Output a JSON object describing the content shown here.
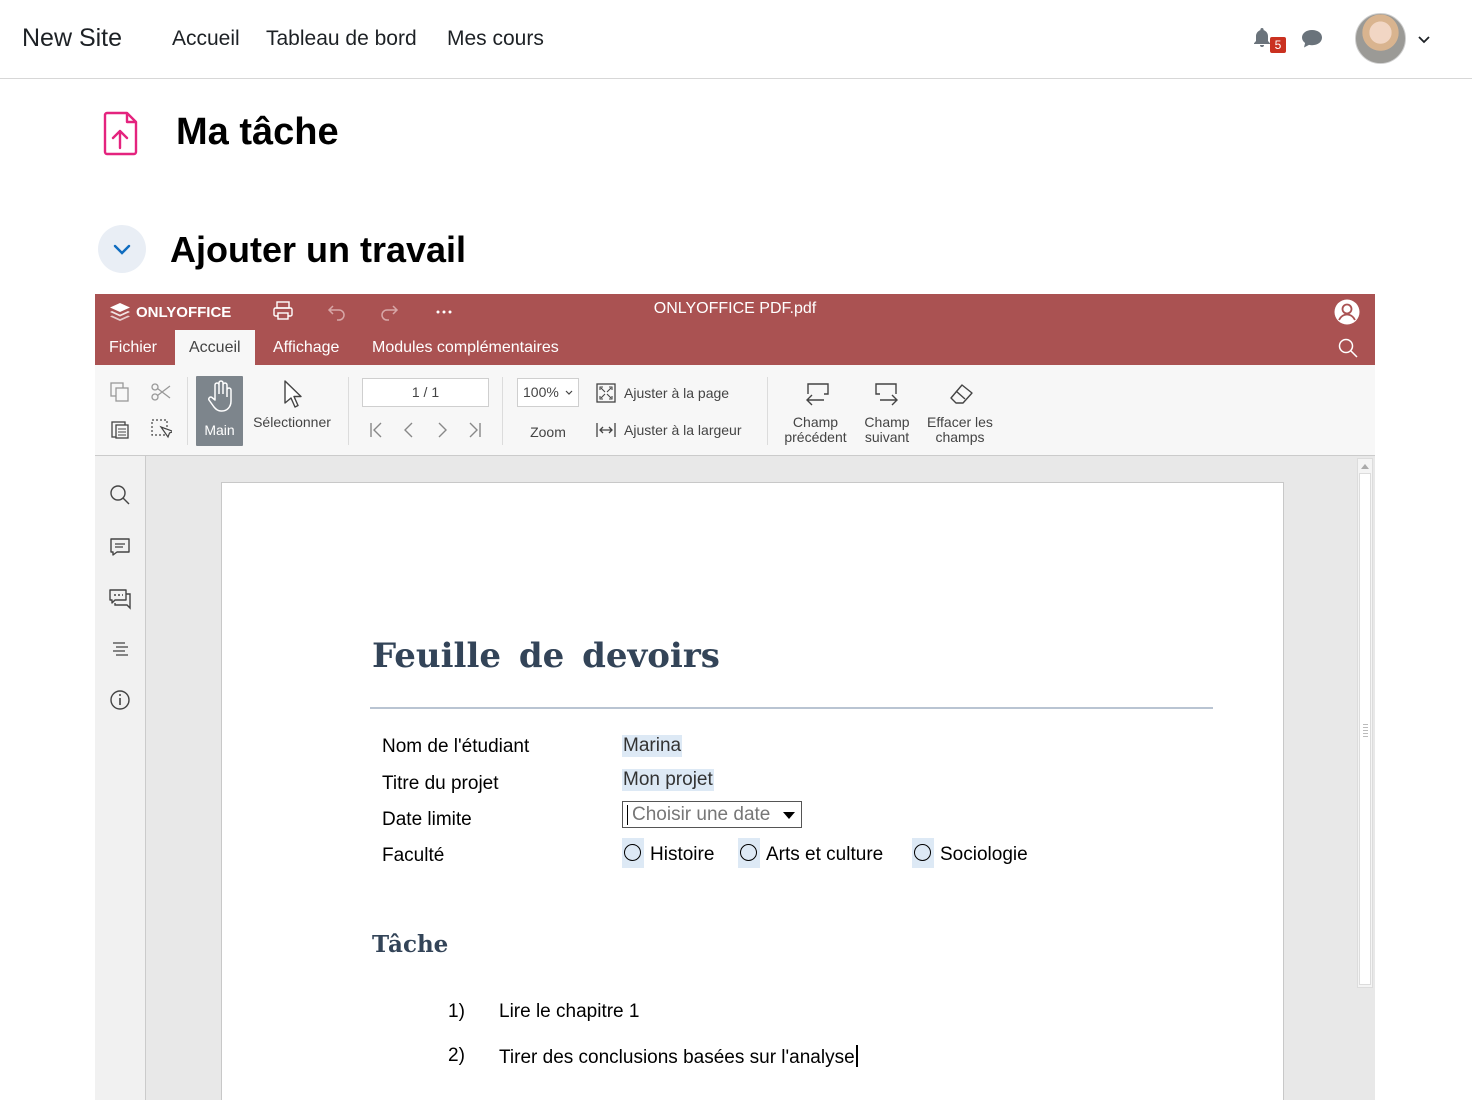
{
  "navbar": {
    "site_name": "New Site",
    "links": [
      "Accueil",
      "Tableau de bord",
      "Mes cours"
    ],
    "notification_count": "5"
  },
  "page": {
    "title": "Ma tâche",
    "section_title": "Ajouter un travail"
  },
  "editor": {
    "brand": "ONLYOFFICE",
    "document_name": "ONLYOFFICE PDF.pdf",
    "accent_color": "#aa5252",
    "tabs": [
      "Fichier",
      "Accueil",
      "Affichage",
      "Modules complémentaires"
    ],
    "active_tab": "Accueil",
    "toolbar": {
      "hand_label": "Main",
      "select_label": "Sélectionner",
      "page_indicator": "1 / 1",
      "zoom_value": "100%",
      "zoom_label": "Zoom",
      "fit_page": "Ajuster à la page",
      "fit_width": "Ajuster à la largeur",
      "prev_field": "Champ précédent",
      "next_field": "Champ suivant",
      "clear_fields": "Effacer les champs"
    },
    "sidebar_icons": [
      "search-icon",
      "comment-icon",
      "chat-icon",
      "navigation-icon",
      "info-icon"
    ]
  },
  "document": {
    "heading": "Feuille de devoirs",
    "fields": [
      {
        "label": "Nom de l'étudiant",
        "value": "Marina"
      },
      {
        "label": "Titre du projet",
        "value": "Mon projet"
      },
      {
        "label": "Date limite",
        "placeholder": "Choisir une date"
      },
      {
        "label": "Faculté"
      }
    ],
    "faculty_options": [
      "Histoire",
      "Arts et culture",
      "Sociologie"
    ],
    "task_heading": "Tâche",
    "tasks": [
      {
        "num": "1)",
        "text": "Lire le chapitre 1"
      },
      {
        "num": "2)",
        "text": "Tirer des conclusions basées sur l'analyse"
      }
    ]
  }
}
